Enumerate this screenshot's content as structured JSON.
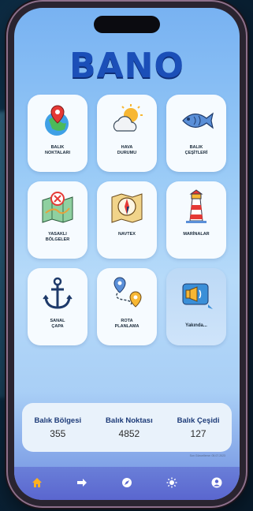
{
  "app": {
    "logo_text": "BANO"
  },
  "tiles": [
    {
      "label": "BALIK\nNOKTALARI",
      "icon": "globe-map-pin-icon"
    },
    {
      "label": "HAVA\nDURUMU",
      "icon": "sun-cloud-icon"
    },
    {
      "label": "BALIK\nÇEŞİTLERİ",
      "icon": "fish-icon"
    },
    {
      "label": "YASAKLI\nBÖLGELER",
      "icon": "forbidden-map-icon"
    },
    {
      "label": "NAVTEX",
      "icon": "compass-map-icon"
    },
    {
      "label": "MARİNALAR",
      "icon": "lighthouse-icon"
    },
    {
      "label": "SANAL\nÇAPA",
      "icon": "anchor-icon"
    },
    {
      "label": "ROTA\nPLANLAMA",
      "icon": "route-pins-icon"
    },
    {
      "label": "Yakında...",
      "icon": "megaphone-icon"
    }
  ],
  "stats": [
    {
      "title": "Balık Bölgesi",
      "value": "355"
    },
    {
      "title": "Balık Noktası",
      "value": "4852"
    },
    {
      "title": "Balık Çeşidi",
      "value": "127"
    }
  ],
  "sync_text": "Son Güncelleme: 05.07.2023",
  "nav": [
    {
      "icon": "home-icon",
      "active": true
    },
    {
      "icon": "arrow-right-icon",
      "active": false
    },
    {
      "icon": "compass-icon",
      "active": false
    },
    {
      "icon": "sun-icon",
      "active": false
    },
    {
      "icon": "profile-icon",
      "active": false
    }
  ],
  "colors": {
    "accent": "#1b4fb8",
    "nav_active": "#ffb020",
    "nav_bg": "#5a66cf"
  }
}
